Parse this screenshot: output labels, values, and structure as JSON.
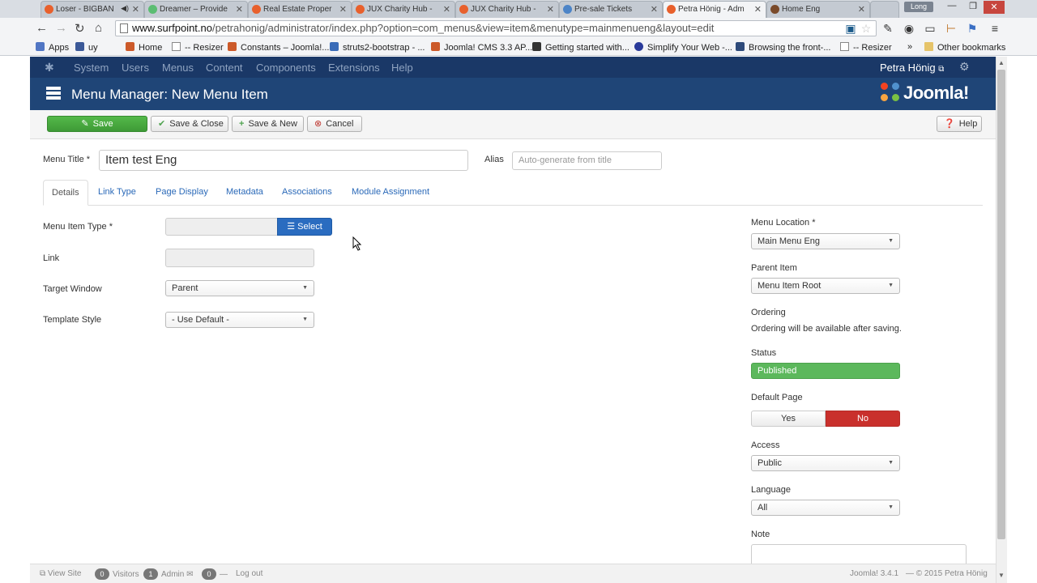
{
  "browser": {
    "tabs": [
      {
        "label": "Loser - BIGBAN",
        "sound": "◀)"
      },
      {
        "label": "Dreamer – Provide"
      },
      {
        "label": "Real Estate Proper"
      },
      {
        "label": "JUX Charity Hub -"
      },
      {
        "label": "JUX Charity Hub -"
      },
      {
        "label": "Pre-sale Tickets"
      },
      {
        "label": "Petra Hönig - Adm"
      },
      {
        "label": "Home Eng"
      }
    ],
    "user_badge": "Long",
    "url_host": "www.surfpoint.no",
    "url_path": "/petrahonig/administrator/index.php?option=com_menus&view=item&menutype=mainmenueng&layout=edit",
    "bookmarks": [
      "Apps",
      "uy",
      "Home",
      "-- Resizer",
      "Constants – Joomla!...",
      "struts2-bootstrap - ...",
      "Joomla! CMS 3.3 AP...",
      "Getting started with...",
      "Simplify Your Web -...",
      "Browsing the front-...",
      "-- Resizer"
    ],
    "bookmarks_overflow": "»",
    "other_bookmarks": "Other bookmarks"
  },
  "admin": {
    "top_menu": [
      "System",
      "Users",
      "Menus",
      "Content",
      "Components",
      "Extensions",
      "Help"
    ],
    "user": "Petra Hönig",
    "page_title": "Menu Manager: New Menu Item",
    "brand": "Joomla!"
  },
  "toolbar": {
    "save": "Save",
    "save_close": "Save & Close",
    "save_new": "Save & New",
    "cancel": "Cancel",
    "help": "Help"
  },
  "form": {
    "menu_title_label": "Menu Title *",
    "menu_title_value": "Item test Eng",
    "alias_label": "Alias",
    "alias_placeholder": "Auto-generate from title",
    "tabs": [
      "Details",
      "Link Type",
      "Page Display",
      "Metadata",
      "Associations",
      "Module Assignment"
    ],
    "menu_item_type_label": "Menu Item Type *",
    "select_button": "Select",
    "link_label": "Link",
    "target_window_label": "Target Window",
    "target_window_value": "Parent",
    "template_style_label": "Template Style",
    "template_style_value": "- Use Default -"
  },
  "sidebar": {
    "menu_location_label": "Menu Location *",
    "menu_location_value": "Main Menu Eng",
    "parent_item_label": "Parent Item",
    "parent_item_value": "Menu Item Root",
    "ordering_label": "Ordering",
    "ordering_text": "Ordering will be available after saving.",
    "status_label": "Status",
    "status_value": "Published",
    "default_page_label": "Default Page",
    "default_yes": "Yes",
    "default_no": "No",
    "access_label": "Access",
    "access_value": "Public",
    "language_label": "Language",
    "language_value": "All",
    "note_label": "Note"
  },
  "statusbar": {
    "view_site": "View Site",
    "visitors_count": "0",
    "visitors": "Visitors",
    "admin_count": "1",
    "admin": "Admin",
    "messages_count": "0",
    "logout": "Log out",
    "version": "Joomla! 3.4.1",
    "copyright": "— © 2015 Petra Hönig"
  },
  "colors": {
    "topnav": "#1a3867",
    "subhead": "#1f4577",
    "save_green": "#46a546",
    "published_green": "#5cb85c",
    "no_red": "#c9302c",
    "link_blue": "#2a69b8"
  }
}
